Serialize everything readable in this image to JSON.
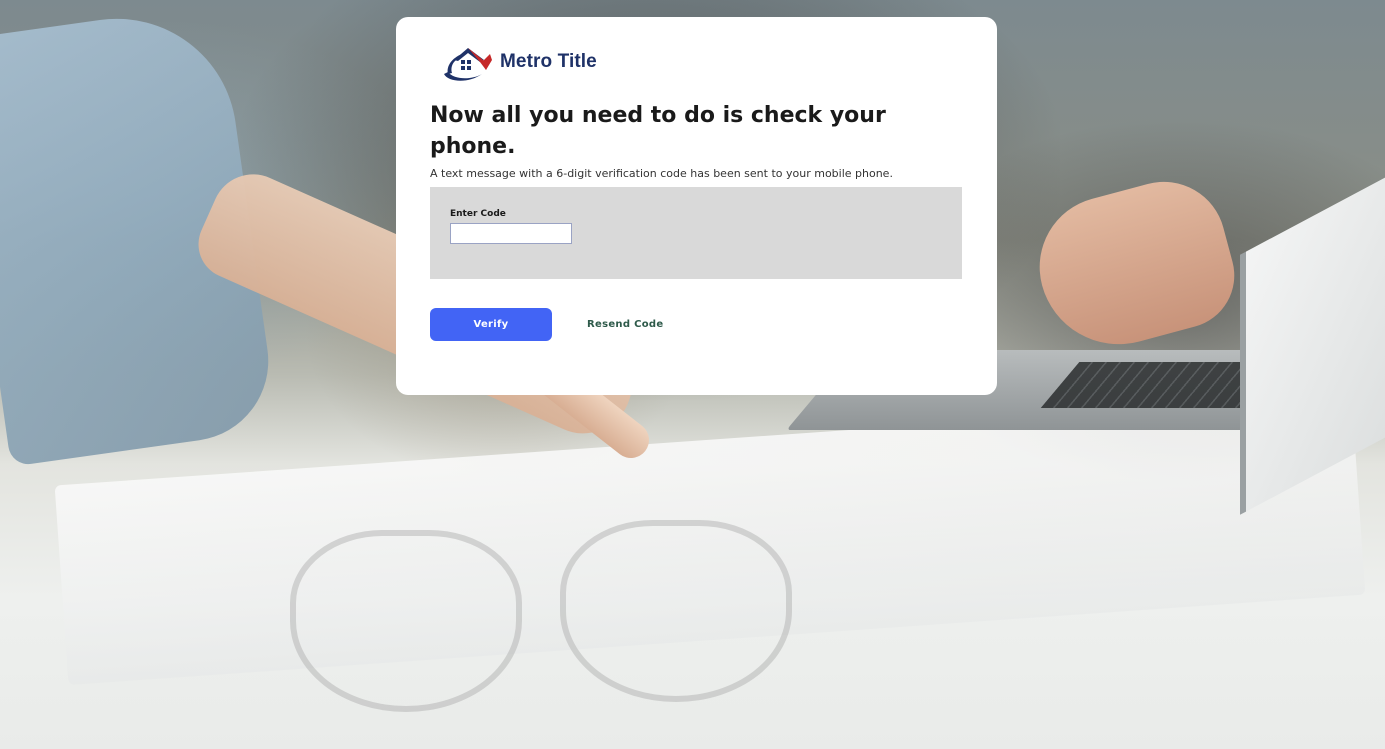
{
  "brand": {
    "name": "Metro Title",
    "logo_icon": "house-swoosh-icon",
    "colors": {
      "navy": "#1f3268",
      "red": "#c62828",
      "accent_blue": "#4264f5"
    }
  },
  "verification": {
    "headline": "Now all you need to do is check your phone.",
    "message": "A text message with a 6-digit verification code has been sent to your mobile phone.",
    "code_field": {
      "label": "Enter Code",
      "value": "",
      "placeholder": ""
    },
    "verify_label": "Verify",
    "resend_label": "Resend Code"
  }
}
